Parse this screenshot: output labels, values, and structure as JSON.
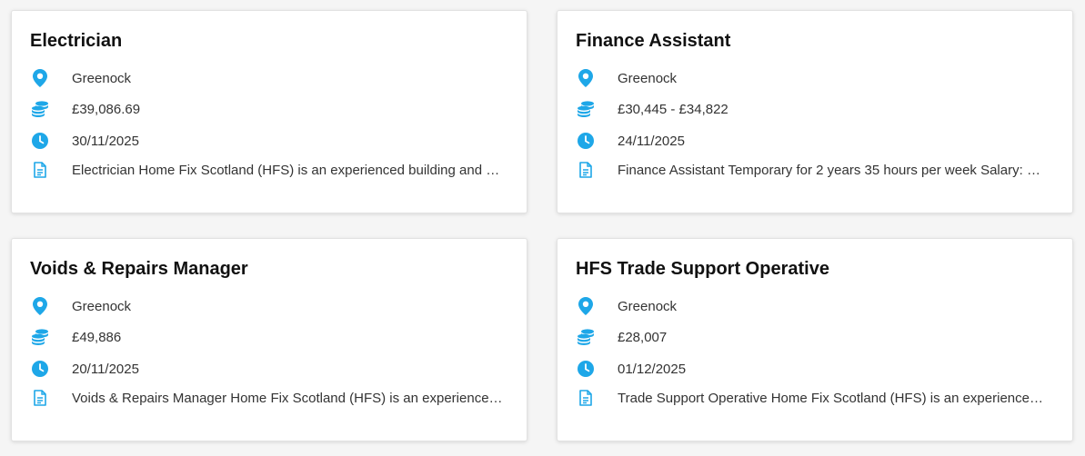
{
  "accent_color": "#1ea7e8",
  "icons": {
    "location": "map-pin-icon",
    "salary": "coins-icon",
    "date": "clock-icon",
    "description": "document-icon"
  },
  "jobs": [
    {
      "title": "Electrician",
      "location": "Greenock",
      "salary": "£39,086.69",
      "closing_date": "30/11/2025",
      "description": "Electrician Home Fix Scotland (HFS) is an experienced building and maintenance contractor"
    },
    {
      "title": "Finance Assistant",
      "location": "Greenock",
      "salary": "£30,445 - £34,822",
      "closing_date": "24/11/2025",
      "description": "Finance Assistant Temporary for 2 years 35 hours per week Salary: Grade"
    },
    {
      "title": "Voids & Repairs Manager",
      "location": "Greenock",
      "salary": "£49,886",
      "closing_date": "20/11/2025",
      "description": "Voids & Repairs Manager Home Fix Scotland (HFS) is an experienced building contractor"
    },
    {
      "title": "HFS Trade Support Operative",
      "location": "Greenock",
      "salary": "£28,007",
      "closing_date": "01/12/2025",
      "description": "Trade Support Operative Home Fix Scotland (HFS) is an experienced building contractor"
    }
  ]
}
